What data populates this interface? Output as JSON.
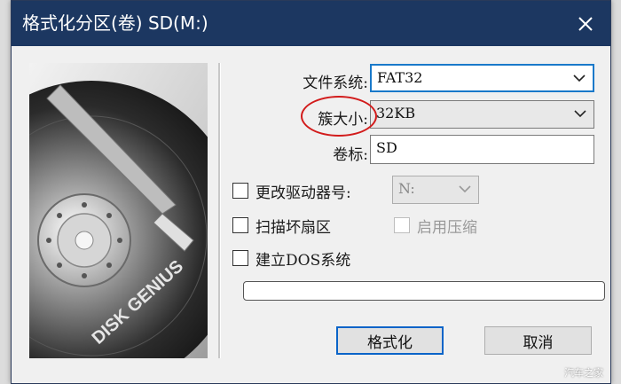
{
  "window": {
    "title": "格式化分区(卷) SD(M:)"
  },
  "side_image": {
    "brand_text": "DISK GENIUS"
  },
  "fields": {
    "filesystem_label": "文件系统:",
    "filesystem_value": "FAT32",
    "cluster_label": "簇大小:",
    "cluster_value": "32KB",
    "volume_label": "卷标:",
    "volume_value": "SD"
  },
  "options": {
    "change_drive_letter": "更改驱动器号:",
    "drive_letter_value": "N:",
    "scan_bad_sectors": "扫描坏扇区",
    "enable_compression": "启用压缩",
    "create_dos": "建立DOS系统"
  },
  "progress": {
    "value": 0
  },
  "buttons": {
    "format": "格式化",
    "cancel": "取消"
  },
  "watermark": "汽车之家",
  "colors": {
    "titlebar": "#1c3761",
    "accent": "#1979ca",
    "annotation": "#d21b1b"
  }
}
